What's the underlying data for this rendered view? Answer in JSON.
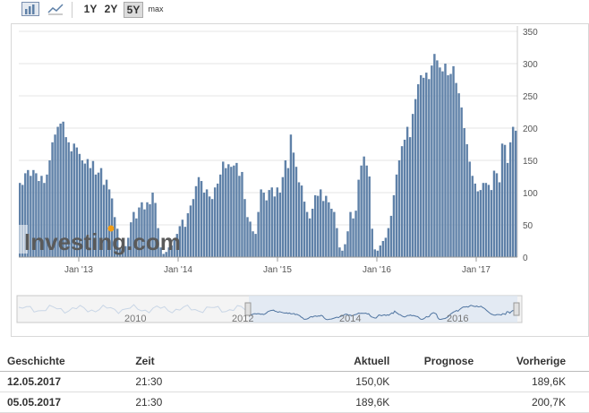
{
  "toolbar": {
    "ranges": [
      "1Y",
      "2Y",
      "5Y",
      "max"
    ],
    "active_range": "5Y"
  },
  "chart_data": {
    "type": "bar",
    "x_ticks": [
      "Jan '13",
      "Jan '14",
      "Jan '15",
      "Jan '16",
      "Jan '17"
    ],
    "y_ticks": [
      "0",
      "50",
      "100",
      "150",
      "200",
      "250",
      "300",
      "350"
    ],
    "ylim": [
      0,
      350
    ],
    "grid": true,
    "watermark": "Investing.com",
    "colors": {
      "bar": "#5f81a8",
      "bar_faded": "#b9c8da",
      "grid": "#e6e6e6"
    },
    "values": [
      115,
      112,
      130,
      135,
      126,
      135,
      130,
      118,
      126,
      115,
      128,
      150,
      178,
      190,
      202,
      207,
      210,
      186,
      178,
      164,
      176,
      170,
      160,
      150,
      145,
      152,
      138,
      149,
      128,
      131,
      138,
      112,
      120,
      105,
      91,
      62,
      44,
      14,
      11,
      17,
      30,
      54,
      70,
      60,
      77,
      85,
      74,
      85,
      82,
      100,
      84,
      45,
      15,
      5,
      8,
      15,
      18,
      28,
      36,
      48,
      58,
      47,
      68,
      80,
      90,
      110,
      124,
      118,
      100,
      105,
      94,
      90,
      108,
      114,
      128,
      148,
      138,
      144,
      140,
      142,
      146,
      126,
      132,
      90,
      62,
      55,
      40,
      36,
      70,
      105,
      100,
      88,
      104,
      108,
      94,
      108,
      100,
      124,
      150,
      138,
      190,
      162,
      140,
      116,
      111,
      86,
      70,
      60,
      75,
      96,
      95,
      105,
      87,
      95,
      85,
      75,
      70,
      45,
      15,
      10,
      20,
      40,
      70,
      60,
      72,
      120,
      142,
      156,
      142,
      125,
      44,
      12,
      10,
      18,
      25,
      30,
      45,
      64,
      96,
      128,
      150,
      172,
      182,
      202,
      186,
      222,
      245,
      268,
      282,
      278,
      286,
      276,
      297,
      315,
      305,
      294,
      288,
      300,
      282,
      284,
      296,
      270,
      254,
      232,
      200,
      175,
      148,
      126,
      114,
      102,
      104,
      115,
      115,
      112,
      104,
      134,
      130,
      116,
      176,
      174,
      146,
      178,
      202,
      196
    ]
  },
  "navigator": {
    "labels": [
      "2010",
      "2012",
      "2014",
      "2016"
    ]
  },
  "table": {
    "headers": [
      "Geschichte",
      "Zeit",
      "Aktuell",
      "Prognose",
      "Vorherige"
    ],
    "rows": [
      [
        "12.05.2017",
        "21:30",
        "150,0K",
        "",
        "189,6K"
      ],
      [
        "05.05.2017",
        "21:30",
        "189,6K",
        "",
        "200,7K"
      ]
    ]
  }
}
